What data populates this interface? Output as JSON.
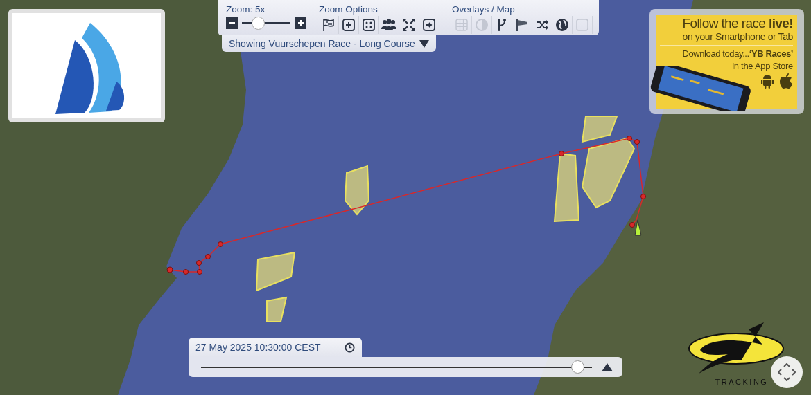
{
  "zoom": {
    "label": "Zoom: 5x",
    "level": 0.33
  },
  "zoom_options": {
    "title": "Zoom Options"
  },
  "overlays": {
    "title": "Overlays / Map",
    "buttons": [
      {
        "on": false
      },
      {
        "on": false
      },
      {
        "on": true
      },
      {
        "on": true
      },
      {
        "on": true
      },
      {
        "on": true
      },
      {
        "on": false
      }
    ]
  },
  "race_selector": {
    "label": "Showing Vuurschepen Race - Long Course"
  },
  "app_banner": {
    "headline": "Follow the race **live!**",
    "subline": "on your Smartphone or Tab",
    "download": "Download today...**‘YB Races’**",
    "store": "in the App Store"
  },
  "timeline": {
    "time": "27 May 2025 10:30:00 CEST",
    "level": 0.965
  },
  "tracking_logo": {
    "label": "TRACKING"
  }
}
